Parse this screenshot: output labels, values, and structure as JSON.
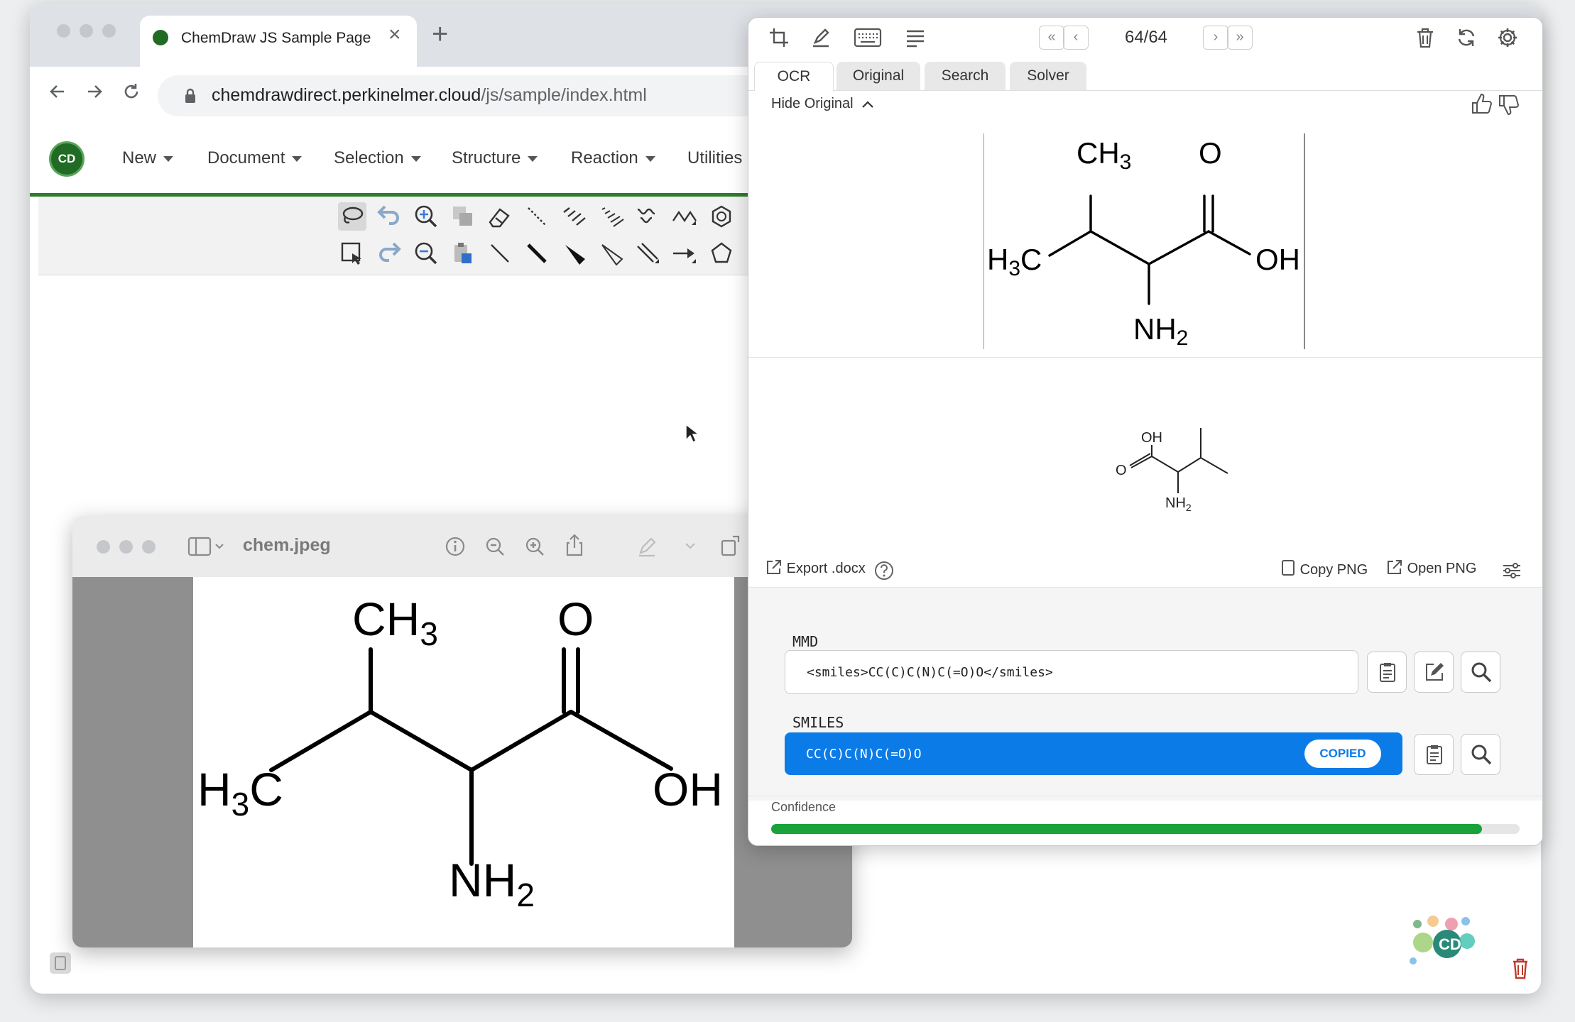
{
  "browser": {
    "tab_title": "ChemDraw JS Sample Page",
    "tab_close": "×",
    "new_tab": "+",
    "url_host": "chemdrawdirect.perkinelmer.cloud",
    "url_path": "/js/sample/index.html"
  },
  "app": {
    "logo": "CD",
    "menu": [
      "New",
      "Document",
      "Selection",
      "Structure",
      "Reaction",
      "Utilities"
    ]
  },
  "preview": {
    "filename": "chem.jpeg"
  },
  "molecule_labels": {
    "ch3": "CH",
    "ch3_sub": "3",
    "h3c": "H",
    "h3c_sub": "3",
    "h3c_c": "C",
    "o": "O",
    "oh": "OH",
    "nh2": "NH",
    "nh2_sub": "2"
  },
  "ocr": {
    "counter": "64/64",
    "tabs": [
      "OCR",
      "Original",
      "Search",
      "Solver"
    ],
    "active_tab": "OCR",
    "hide_original": "Hide Original",
    "export_docx": "Export .docx",
    "copy_png": "Copy PNG",
    "open_png": "Open PNG",
    "mmd_label": "MMD",
    "mmd_value": "<smiles>CC(C)C(N)C(=O)O</smiles>",
    "smiles_label": "SMILES",
    "smiles_value": "CC(C)C(N)C(=O)O",
    "copied_badge": "COPIED",
    "confidence_label": "Confidence",
    "confidence": 0.95
  },
  "colors": {
    "accent_blue": "#0b7be8",
    "confidence_green": "#19a33a",
    "chemdraw_green": "#2d7d2e"
  }
}
